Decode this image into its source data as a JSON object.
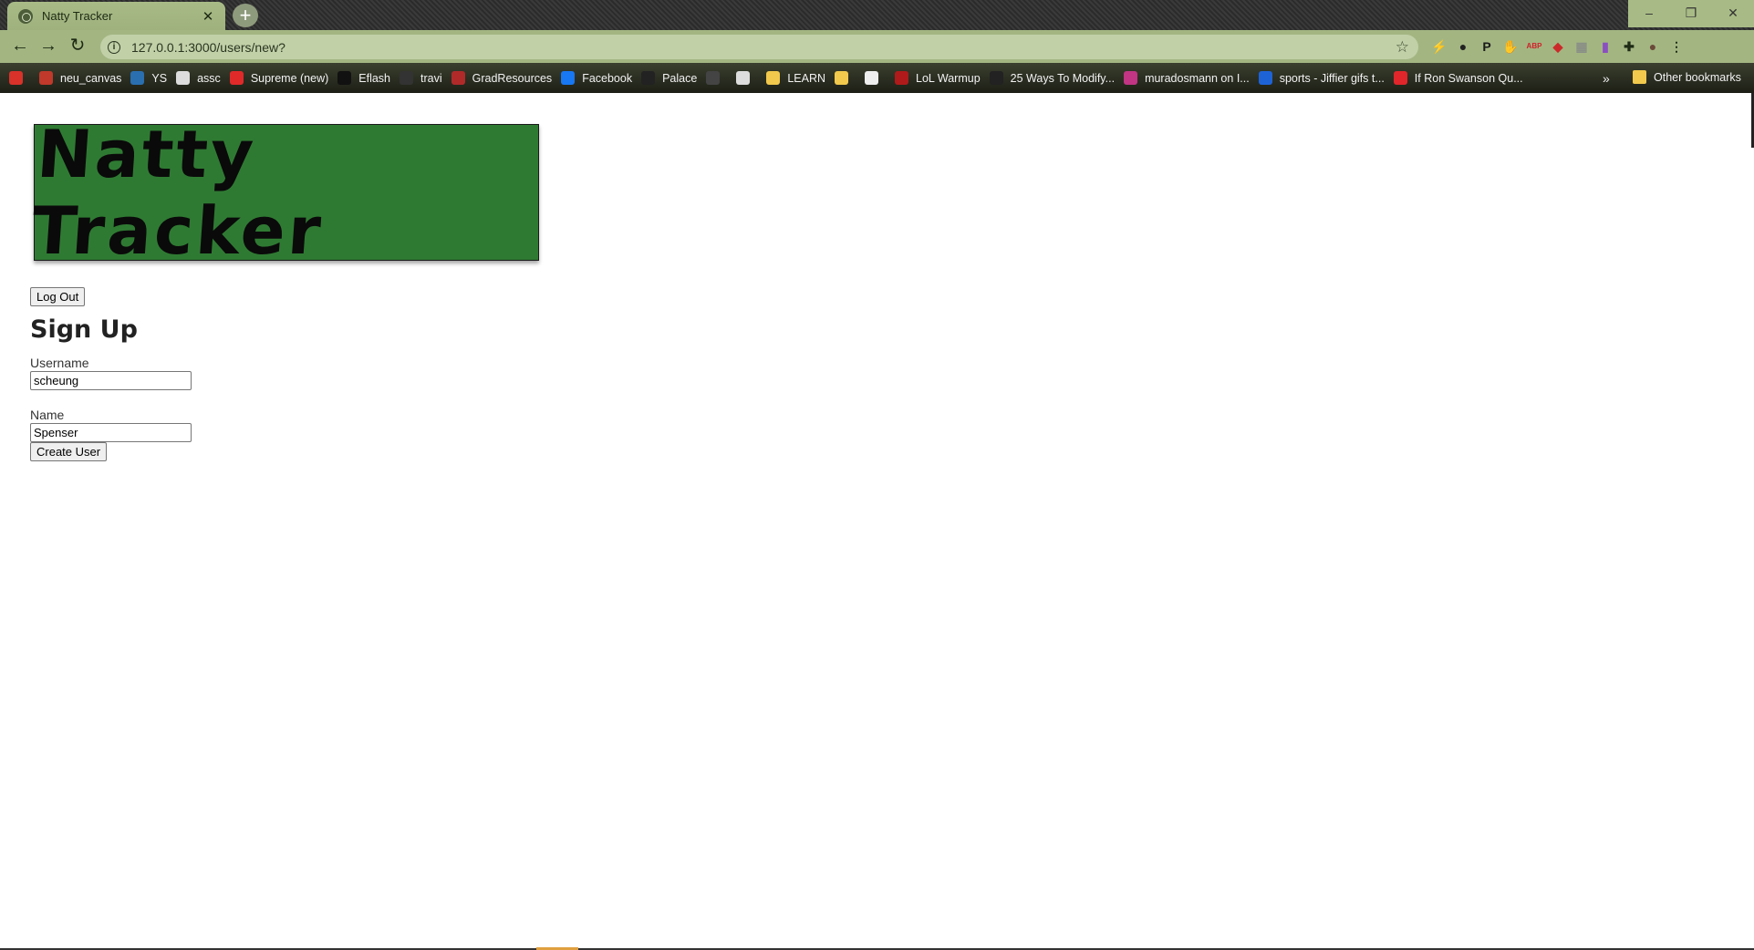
{
  "browser": {
    "tab_title": "Natty Tracker",
    "tab_close": "✕",
    "new_tab": "+",
    "url": "127.0.0.1:3000/users/new?",
    "window_controls": [
      "–",
      "❐",
      "✕"
    ],
    "back_icon": "←",
    "forward_icon": "→",
    "reload_icon": "↻",
    "star_icon": "☆",
    "extensions": [
      {
        "name": "bolt-extension-icon",
        "glyph": "⚡",
        "color": "#b89a2a"
      },
      {
        "name": "bomb-extension-icon",
        "glyph": "●",
        "color": "#222222"
      },
      {
        "name": "p-extension-icon",
        "glyph": "P",
        "color": "#1a1a1a"
      },
      {
        "name": "hand-extension-icon",
        "glyph": "✋",
        "color": "#d62020"
      },
      {
        "name": "adblock-extension-icon",
        "glyph": "ABP",
        "color": "#d0202a"
      },
      {
        "name": "red-extension-icon",
        "glyph": "◆",
        "color": "#cc2a2a"
      },
      {
        "name": "grey-extension-icon",
        "glyph": "▦",
        "color": "#8a8f86"
      },
      {
        "name": "purple-extension-icon",
        "glyph": "▮",
        "color": "#8a4fc0"
      },
      {
        "name": "puzzle-extension-icon",
        "glyph": "✚",
        "color": "#1e2a14"
      },
      {
        "name": "profile-avatar-icon",
        "glyph": "●",
        "color": "#6b4a3a"
      },
      {
        "name": "menu-dots-icon",
        "glyph": "⋮",
        "color": "#1e2a14"
      }
    ],
    "bookmarks": [
      {
        "label": "",
        "color": "#d8322a"
      },
      {
        "label": "neu_canvas",
        "color": "#c0392b"
      },
      {
        "label": "YS",
        "color": "#2a6fb0"
      },
      {
        "label": "assc",
        "color": "#dddddd"
      },
      {
        "label": "Supreme (new)",
        "color": "#e02a2a"
      },
      {
        "label": "Eflash",
        "color": "#111111"
      },
      {
        "label": "travi",
        "color": "#333333"
      },
      {
        "label": "GradResources",
        "color": "#b02a2a"
      },
      {
        "label": "Facebook",
        "color": "#1877f2"
      },
      {
        "label": "Palace",
        "color": "#222222"
      },
      {
        "label": "",
        "color": "#444444"
      },
      {
        "label": "",
        "color": "#dddddd"
      },
      {
        "label": "LEARN",
        "color": "#f2c94c"
      },
      {
        "label": "",
        "color": "#f2c94c"
      },
      {
        "label": "",
        "color": "#eeeeee"
      },
      {
        "label": "LoL Warmup",
        "color": "#b01a1a"
      },
      {
        "label": "25 Ways To Modify...",
        "color": "#222222"
      },
      {
        "label": "muradosmann on I...",
        "color": "#c13584"
      },
      {
        "label": "sports - Jiffier gifs t...",
        "color": "#1e63d6"
      },
      {
        "label": "If Ron Swanson Qu...",
        "color": "#e0262a"
      }
    ],
    "bookmarks_more": "»",
    "other_bookmarks": "Other bookmarks"
  },
  "page": {
    "banner_title": "Natty Tracker",
    "logout_label": "Log Out",
    "heading": "Sign Up",
    "username_label": "Username",
    "username_value": "scheung",
    "name_label": "Name",
    "name_value": "Spenser",
    "submit_label": "Create User"
  }
}
